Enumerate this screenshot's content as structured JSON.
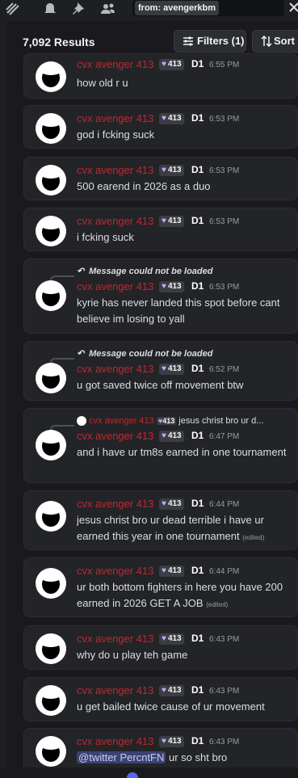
{
  "search": {
    "query": "from: avengerkbm"
  },
  "results": {
    "count_text": "7,092 Results"
  },
  "toolbar": {
    "filters_label": "Filters (1)",
    "sort_label": "Sort"
  },
  "user": {
    "name": "cvx avenger 413",
    "tag": "413",
    "clan": "D1"
  },
  "messages": [
    {
      "time": "6:55 PM",
      "text": "how old r u"
    },
    {
      "time": "6:53 PM",
      "text": "god i fcking suck"
    },
    {
      "time": "6:53 PM",
      "text": "500 earend in 2026 as a duo"
    },
    {
      "time": "6:53 PM",
      "text": "i fcking suck"
    },
    {
      "time": "6:53 PM",
      "reply": "Message could not be loaded",
      "text": "kyrie has never landed this spot before cant believe im losing to yall"
    },
    {
      "time": "6:52 PM",
      "reply": "Message could not be loaded",
      "text": "u got saved twice off movement btw"
    },
    {
      "time": "6:47 PM",
      "reply_user": "cvx avenger 413",
      "reply_tag": "413",
      "reply_text": "jesus christ bro ur d...",
      "text": "and i have ur tm8s earned in one tournament"
    },
    {
      "time": "6:44 PM",
      "text": "jesus christ bro ur dead terrible i have ur earned this year in one tournament",
      "edited": "(edited)"
    },
    {
      "time": "6:44 PM",
      "text": "ur both bottom fighters in here you have 200 earned in 2026 GET A JOB",
      "edited": "(edited)"
    },
    {
      "time": "6:43 PM",
      "text": "why do u play teh game"
    },
    {
      "time": "6:43 PM",
      "text": "u get bailed twice cause of ur movement"
    },
    {
      "time": "6:43 PM",
      "mention": "@twitter PercntFN",
      "text": "ur so sht bro"
    }
  ],
  "colors": {
    "username": "#c0272d",
    "background": "#1a1a1e",
    "card": "#232428",
    "mention_bg": "#3c4270"
  },
  "icons": [
    "threads-icon",
    "bell-icon",
    "pin-icon",
    "members-icon",
    "clear-icon",
    "filter-icon",
    "sort-icon",
    "reply-arrow-icon"
  ]
}
